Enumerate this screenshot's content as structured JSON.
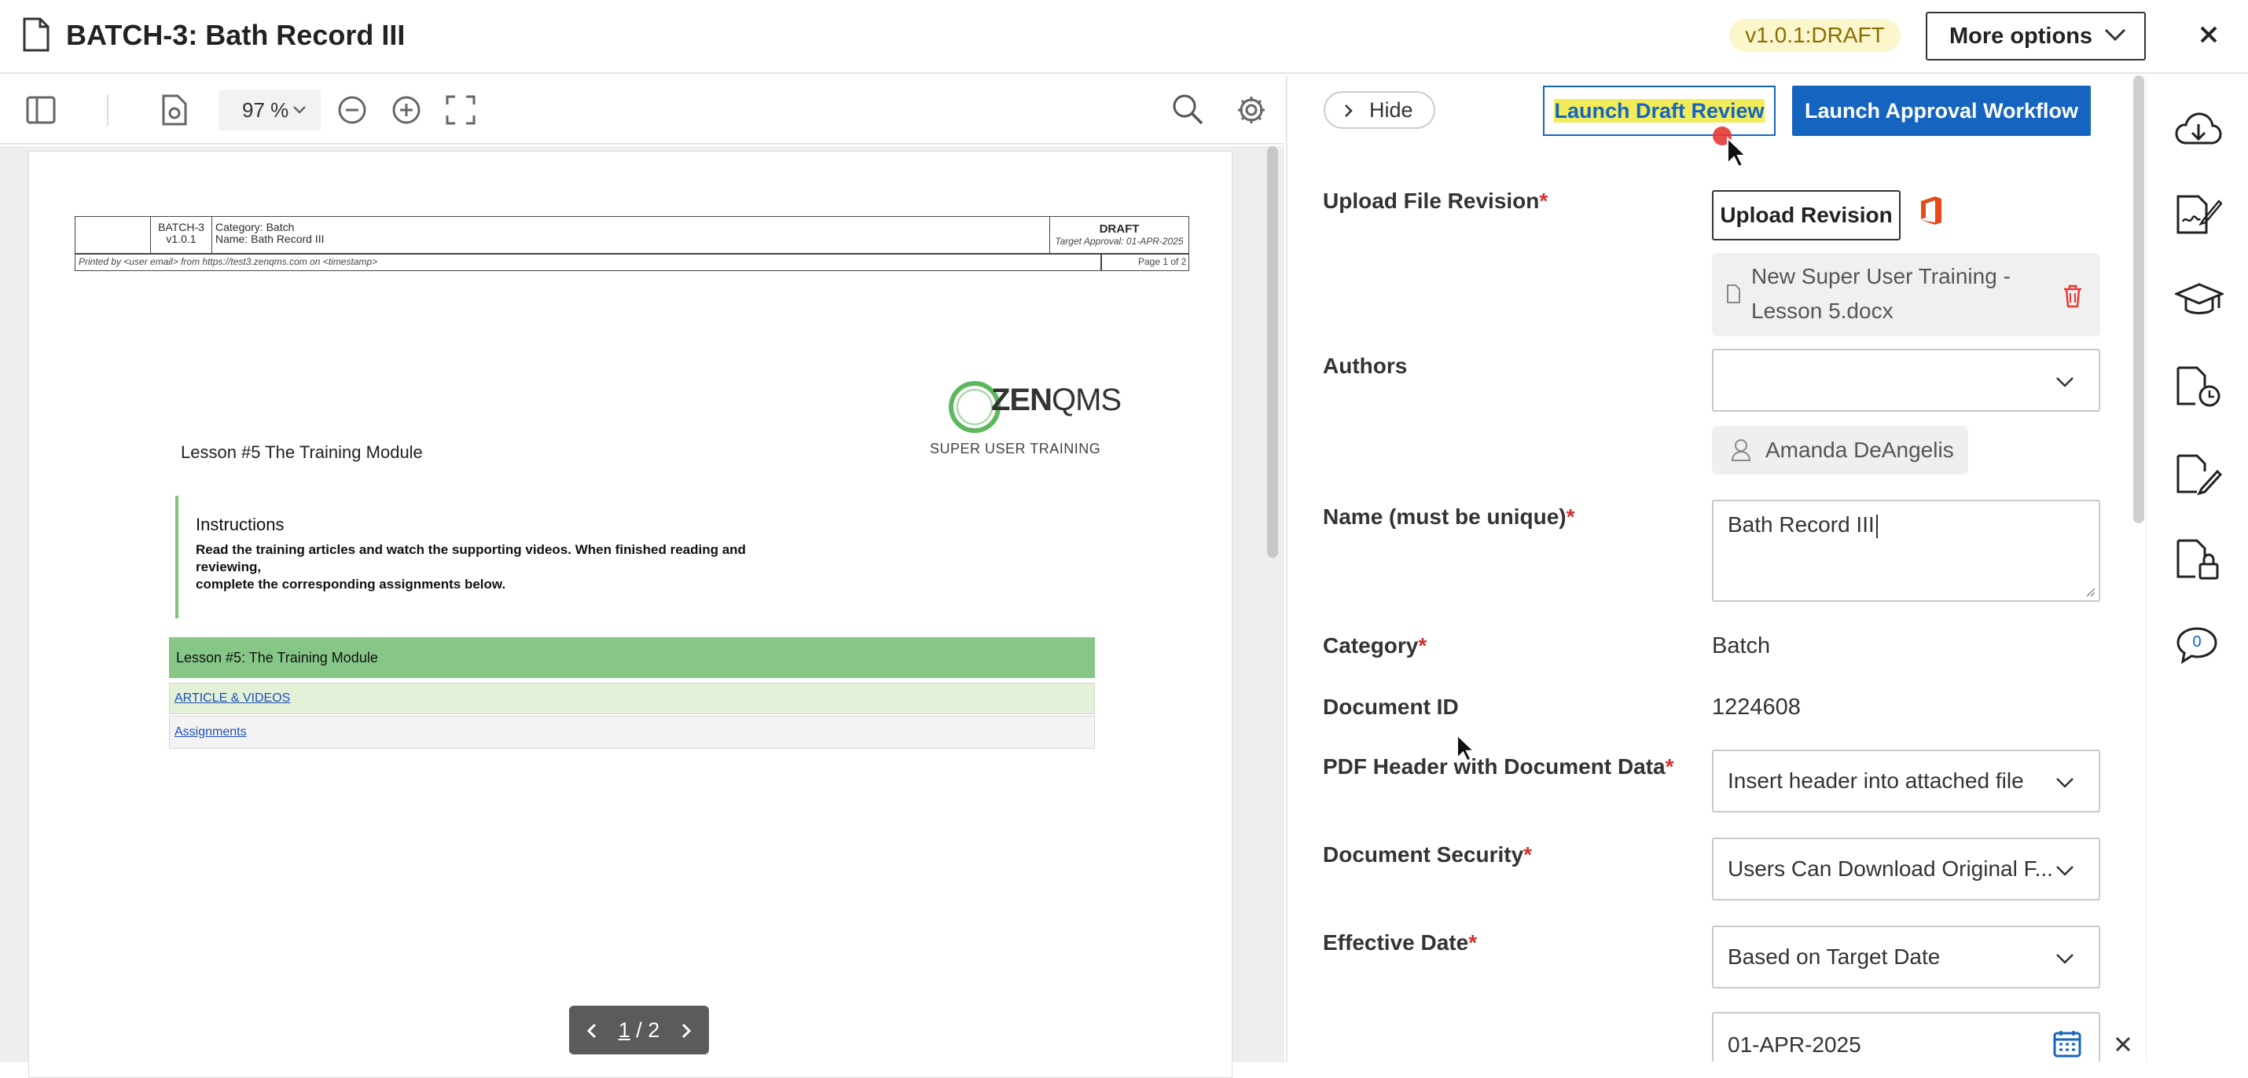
{
  "header": {
    "title": "BATCH-3: Bath Record III",
    "version_badge": "v1.0.1:DRAFT",
    "more_options_label": "More options"
  },
  "viewer_toolbar": {
    "zoom": "97 %"
  },
  "pdf": {
    "header_table": {
      "doc_id": "BATCH-3",
      "version": "v1.0.1",
      "category_line": "Category: Batch",
      "name_line": "Name: Bath Record III",
      "status": "DRAFT",
      "target_approval": "Target Approval: 01-APR-2025",
      "printed_by": "Printed by <user email> from https://test3.zenqms.com on <timestamp>",
      "page_of": "Page 1 of 2"
    },
    "logo_text_bold": "ZEN",
    "logo_text_rest": "QMS",
    "logo_tagline": "SUPER USER TRAINING",
    "lesson_title": "Lesson #5 The Training Module",
    "instructions_heading": "Instructions",
    "instructions_line1": "Read the training articles and watch the supporting videos. When finished reading and reviewing,",
    "instructions_line2": "complete the corresponding assignments below.",
    "module_bar": "Lesson #5: The Training Module",
    "link_articles": "ARTICLE & VIDEOS",
    "link_assignments": "Assignments"
  },
  "pager": {
    "current": "1",
    "sep_total": "/ 2"
  },
  "panel": {
    "hide_label": "Hide",
    "launch_draft_review": "Launch Draft Review",
    "launch_approval": "Launch Approval Workflow",
    "upload_label": "Upload File Revision",
    "upload_button": "Upload Revision",
    "file_name": "New Super User Training - Lesson 5.docx",
    "authors_label": "Authors",
    "authors_value": "",
    "author_chip": "Amanda DeAngelis",
    "name_label": "Name (must be unique)",
    "name_value": "Bath Record III",
    "category_label": "Category",
    "category_value": "Batch",
    "docid_label": "Document ID",
    "docid_value": "1224608",
    "pdf_header_label": "PDF Header with Document Data",
    "pdf_header_value": "Insert header into attached file",
    "security_label": "Document Security",
    "security_value": "Users Can Download Original F...",
    "effective_label": "Effective Date",
    "effective_value": "Based on Target Date",
    "date_value": "01-APR-2025",
    "required_mark": "*"
  },
  "rail": {
    "comment_count": "0"
  },
  "colors": {
    "primary": "#1565c0",
    "required": "#d32f2f",
    "badge_bg": "#fbf6cc",
    "highlight": "#f2ec5a",
    "module_green": "#86c788",
    "delete_red": "#e53935",
    "office_orange": "#e64a19"
  }
}
